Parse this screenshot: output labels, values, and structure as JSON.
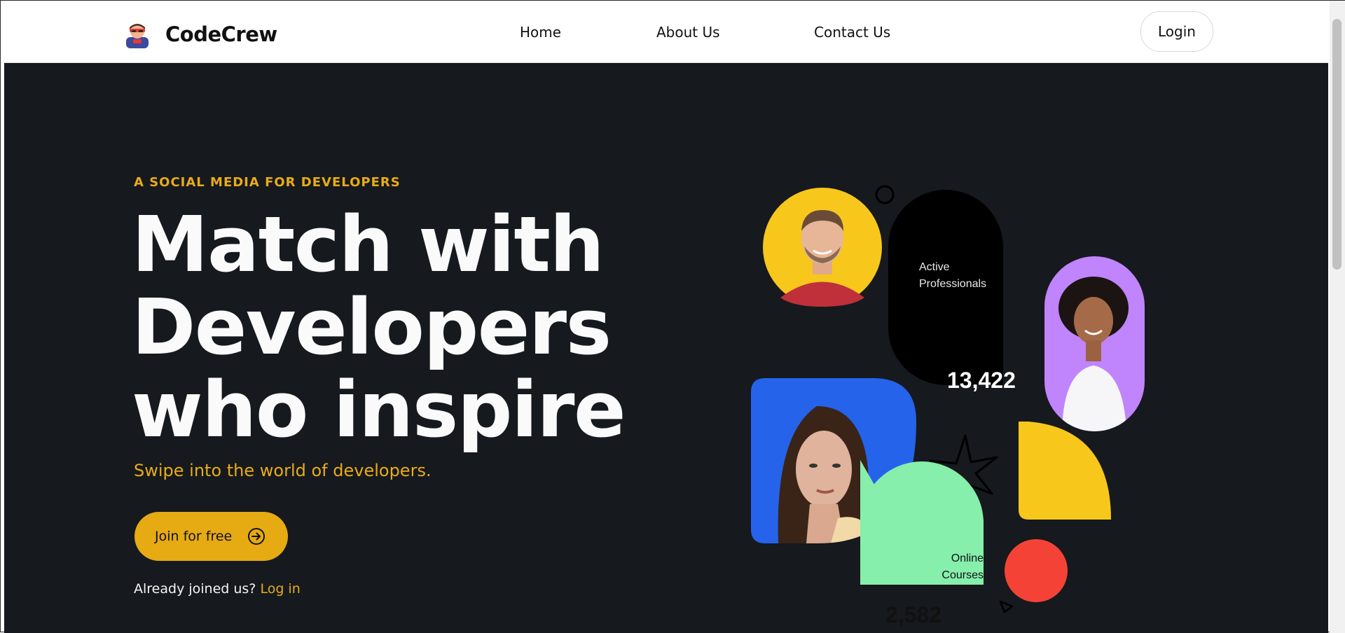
{
  "nav": {
    "brand": "CodeCrew",
    "links": [
      "Home",
      "About Us",
      "Contact Us"
    ],
    "login": "Login"
  },
  "hero": {
    "eyebrow": "A SOCIAL MEDIA FOR DEVELOPERS",
    "headline": [
      "Match with",
      "Developers",
      "who inspire"
    ],
    "subline": "Swipe into the world of developers.",
    "cta": "Join for free",
    "already_text": "Already joined us?",
    "already_link": "Log in"
  },
  "stats": {
    "active_label": "Active Professionals",
    "active_label_lines": [
      "Active",
      "Professionals"
    ],
    "active_value": "13,422",
    "courses_label": "Online Courses",
    "courses_label_lines": [
      "Online",
      "Courses"
    ],
    "courses_value": "2,582"
  },
  "colors": {
    "accent": "#e6aa12",
    "hero_bg": "#16191d",
    "yellow": "#f7c71c",
    "blue": "#2563eb",
    "purple": "#c084fc",
    "green": "#86efac",
    "red": "#f44336"
  },
  "icons": [
    "brand-logo-icon",
    "arrow-right-circle-icon",
    "sparkle-star-icon",
    "ring-icon",
    "triangle-icon"
  ]
}
